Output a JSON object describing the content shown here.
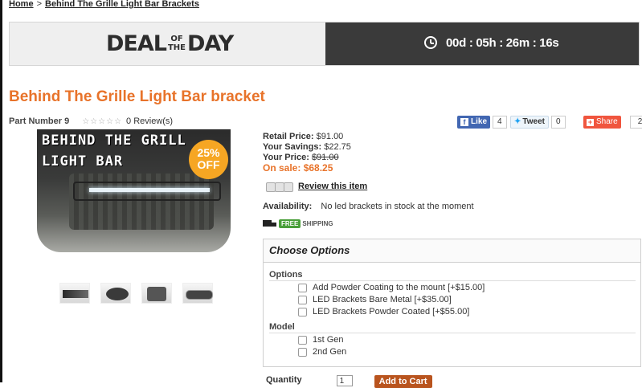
{
  "breadcrumb": {
    "home": "Home",
    "separator": ">",
    "current": "Behind The Grille Light Bar Brackets"
  },
  "deal": {
    "word1": "DEAL",
    "of": "OF",
    "the": "THE",
    "word2": "DAY",
    "countdown": "00d : 05h : 26m : 16s"
  },
  "product": {
    "title": "Behind The Grille Light Bar bracket",
    "part_label": "Part Number 9",
    "stars": "☆☆☆☆☆",
    "reviews": "0 Review(s)",
    "image_text_line1": "BEHIND THE GRILL",
    "image_text_line2": "LIGHT BAR",
    "badge_pct": "25%",
    "badge_off": "OFF"
  },
  "social": {
    "like_label": "Like",
    "like_count": "4",
    "tweet_label": "Tweet",
    "tweet_count": "0",
    "share_label": "Share",
    "share_count": "2"
  },
  "pricing": {
    "retail_label": "Retail Price:",
    "retail_value": "$91.00",
    "savings_label": "Your Savings:",
    "savings_value": "$22.75",
    "your_label": "Your Price:",
    "your_value": "$91.00",
    "sale_label": "On sale:",
    "sale_value": "$68.25"
  },
  "review_link": "Review this item",
  "availability": {
    "label": "Availability:",
    "value": "No led brackets in stock at the moment"
  },
  "shipping": {
    "free": "FREE",
    "shipping": "SHIPPING"
  },
  "options": {
    "header": "Choose Options",
    "group1_label": "Options",
    "group1_items": [
      "Add Powder Coating to the mount [+$15.00]",
      "LED Brackets Bare Metal [+$35.00]",
      "LED Brackets Powder Coated [+$55.00]"
    ],
    "group2_label": "Model",
    "group2_items": [
      "1st Gen",
      "2nd Gen"
    ]
  },
  "purchase": {
    "qty_label": "Quantity",
    "qty_value": "1",
    "add_to_cart": "Add to Cart"
  }
}
